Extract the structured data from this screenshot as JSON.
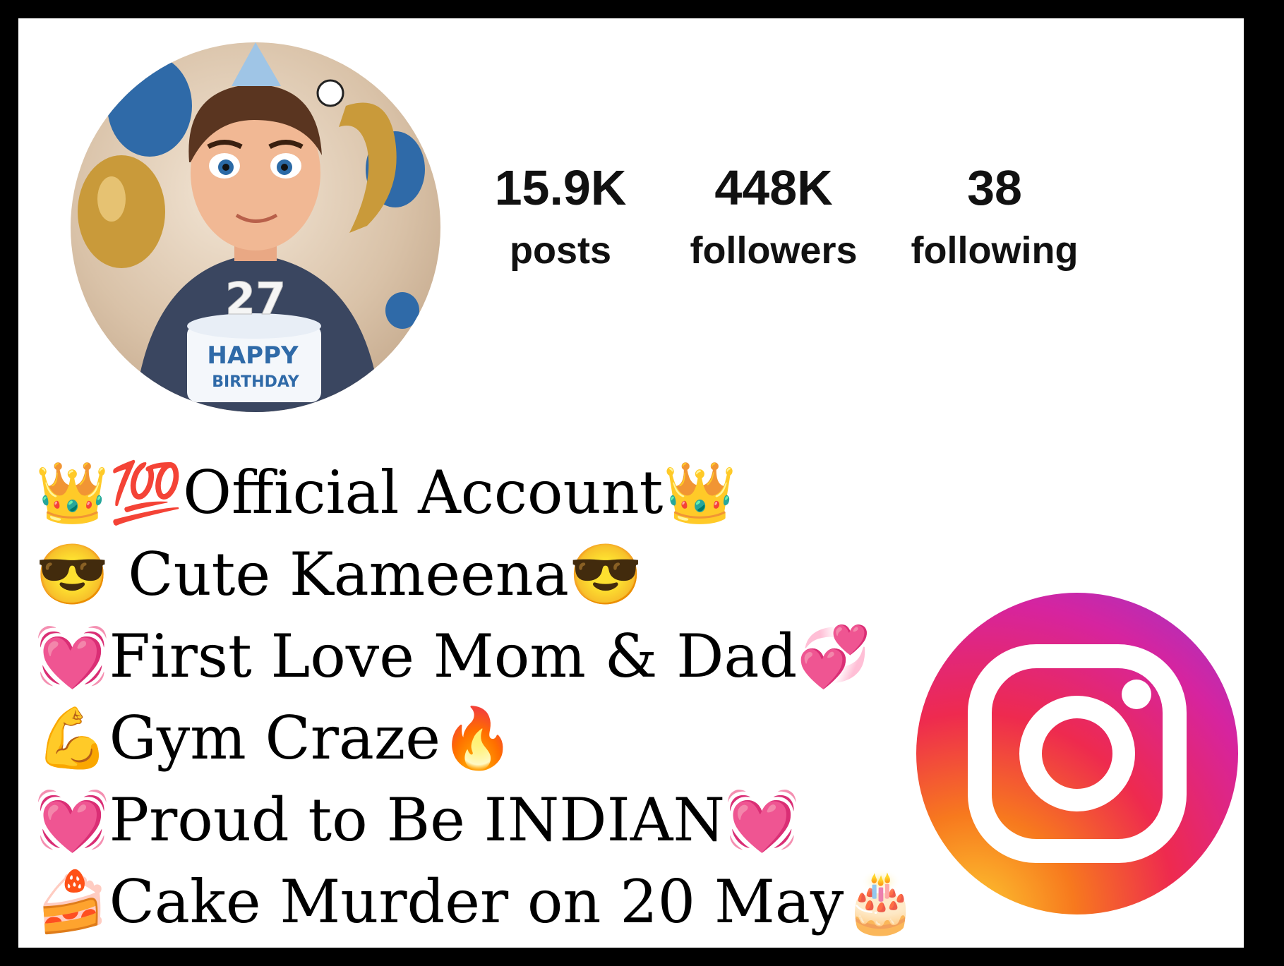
{
  "profile": {
    "avatar_icon": "birthday-avatar",
    "avatar_text": {
      "cake_number": "27",
      "cake_line1": "HAPPY",
      "cake_line2": "BIRTHDAY"
    }
  },
  "stats": {
    "posts": {
      "value": "15.9K",
      "label": "posts"
    },
    "followers": {
      "value": "448K",
      "label": "followers"
    },
    "following": {
      "value": "38",
      "label": "following"
    }
  },
  "bio": [
    "👑💯Official Account👑",
    "😎 Cute Kameena😎",
    "💓First Love Mom & Dad💞",
    "💪Gym Craze🔥",
    "💓Proud to Be INDIAN💓",
    "🍰Cake Murder on 20 May🎂"
  ],
  "logo": {
    "icon": "instagram-icon",
    "gradient": [
      "#fdc830",
      "#f7791e",
      "#ee2a4f",
      "#d6249f",
      "#a034c7"
    ]
  }
}
